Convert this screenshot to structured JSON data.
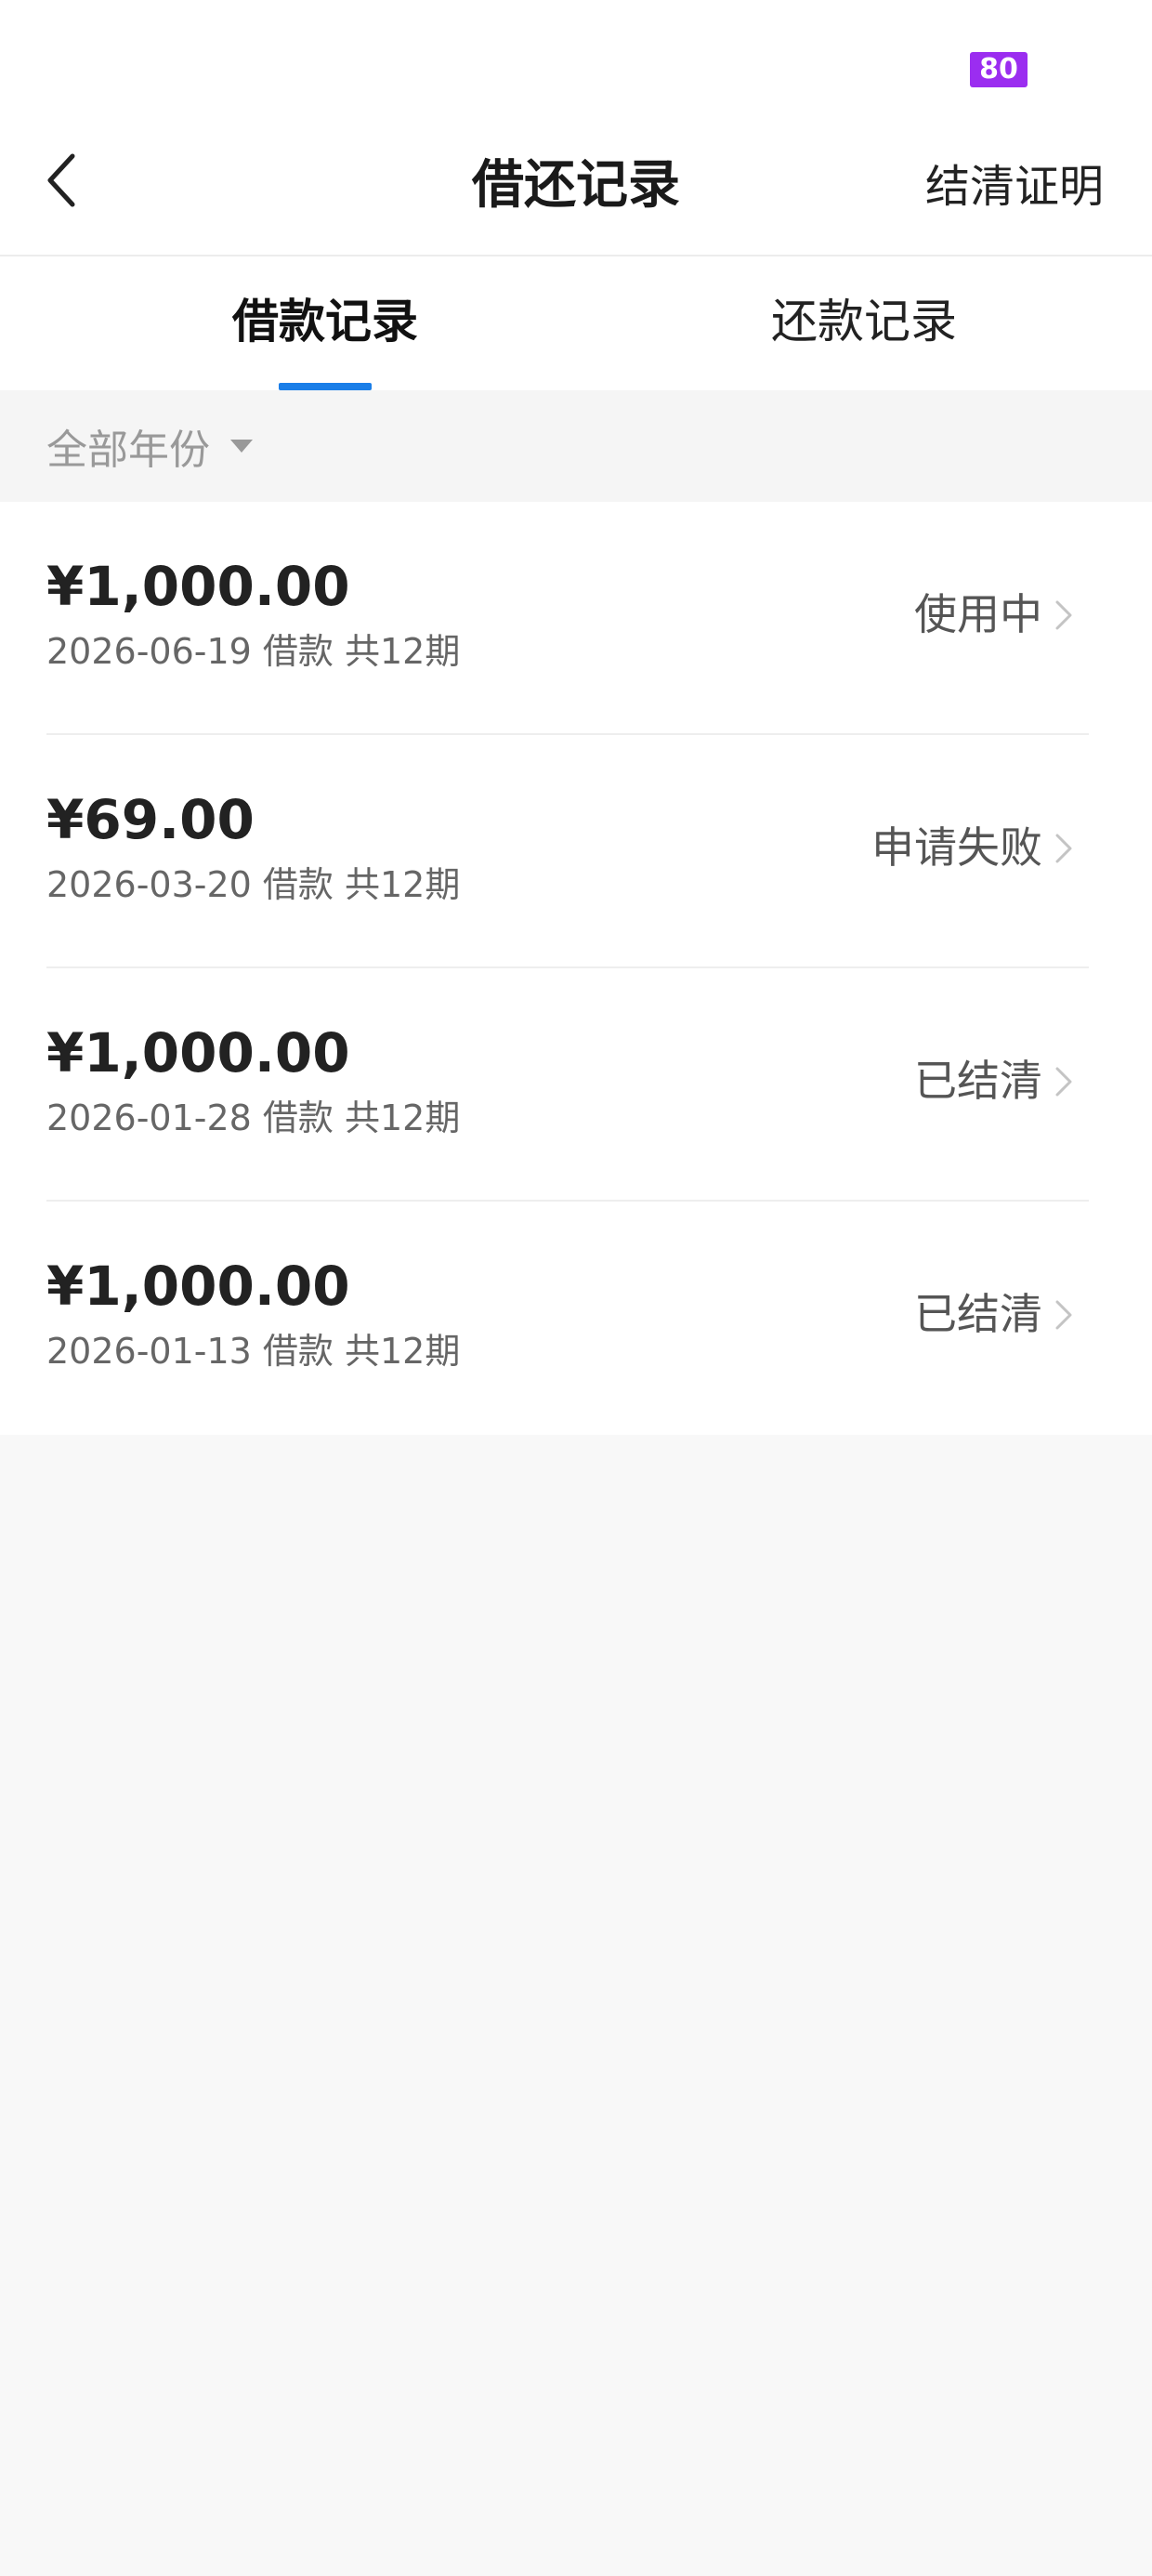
{
  "status_bar": {
    "battery": "80"
  },
  "header": {
    "title": "借还记录",
    "action_label": "结清证明"
  },
  "tabs": [
    {
      "label": "借款记录",
      "active": true
    },
    {
      "label": "还款记录",
      "active": false
    }
  ],
  "filter": {
    "label": "全部年份"
  },
  "records": [
    {
      "amount": "¥1,000.00",
      "meta": "2026-06-19 借款 共12期",
      "status": "使用中"
    },
    {
      "amount": "¥69.00",
      "meta": "2026-03-20 借款 共12期",
      "status": "申请失败"
    },
    {
      "amount": "¥1,000.00",
      "meta": "2026-01-28 借款 共12期",
      "status": "已结清"
    },
    {
      "amount": "¥1,000.00",
      "meta": "2026-01-13 借款 共12期",
      "status": "已结清"
    }
  ],
  "colors": {
    "accent": "#1a7ee8",
    "battery_badge": "#9b2df0",
    "page_background": "#f8f8f8"
  },
  "icons": {
    "back": "chevron-left-icon",
    "filter": "caret-down-icon",
    "record": "chevron-right-icon"
  }
}
